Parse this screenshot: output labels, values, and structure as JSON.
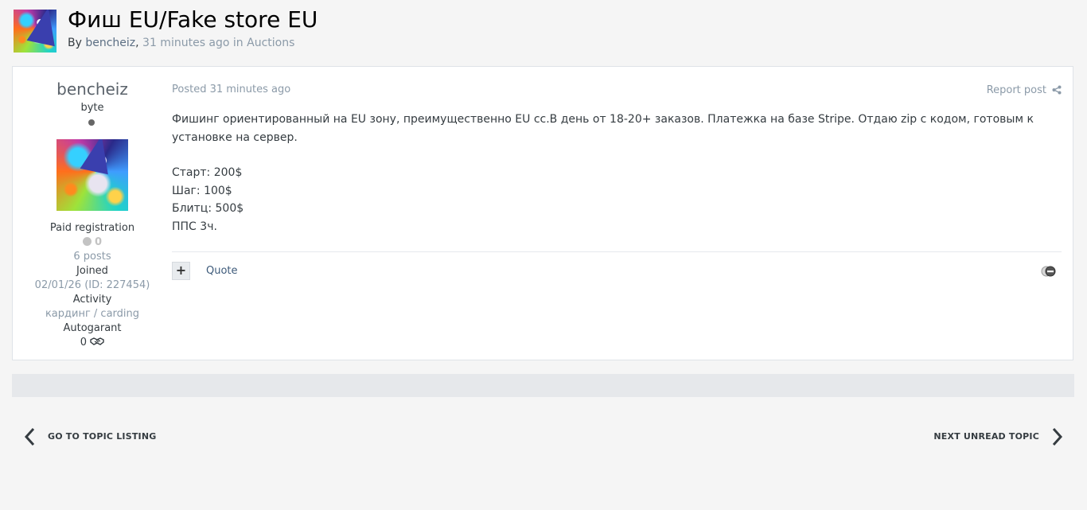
{
  "topic": {
    "title": "Фиш EU/Fake store EU",
    "by_label": "By",
    "author": "bencheiz",
    "comma": ",",
    "time_ago": "31 minutes ago",
    "in_label": "in",
    "forum": "Auctions"
  },
  "author_panel": {
    "name": "bencheiz",
    "rank": "byte",
    "group": "Paid registration",
    "reputation": "0",
    "posts": "6 posts",
    "joined_label": "Joined",
    "joined_value": "02/01/26 (ID: 227454)",
    "activity_label": "Activity",
    "activity_value": "кардинг / carding",
    "autogarant_label": "Autogarant",
    "autogarant_value": "0"
  },
  "post": {
    "posted": "Posted 31 minutes ago",
    "report": "Report post",
    "paragraph1": "Фишинг ориентированный на EU зону, преимущественно EU сс.В день от 18-20+ заказов. Платежка на базе Stripe. Отдаю zip с кодом, готовым к установке на сервер.",
    "lines": [
      "Старт: 200$",
      "Шаг: 100$",
      "Блитц: 500$",
      "ППС 3ч."
    ],
    "plus": "+",
    "quote": "Quote"
  },
  "pager": {
    "prev": "GO TO TOPIC LISTING",
    "next": "NEXT UNREAD TOPIC"
  },
  "icons": [
    "share-icon",
    "reaction-icon",
    "handshake-icon",
    "chevron-left-icon",
    "chevron-right-icon"
  ]
}
